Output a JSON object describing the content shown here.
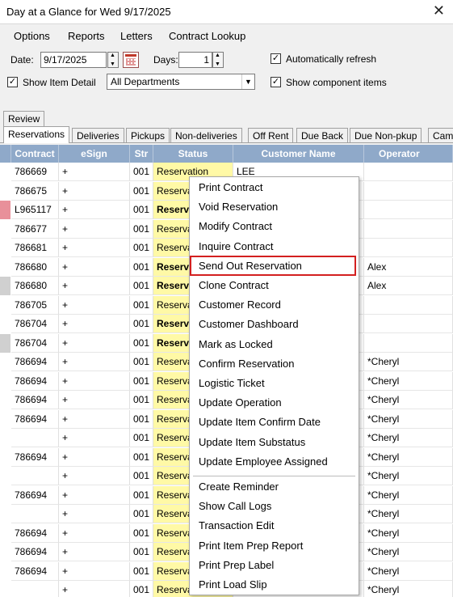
{
  "window": {
    "title": "Day at a Glance for Wed 9/17/2025",
    "close_label": "✕"
  },
  "menu": [
    "Options",
    "Reports",
    "Letters",
    "Contract Lookup"
  ],
  "filters": {
    "date_label": "Date:",
    "date_value": "9/17/2025",
    "days_label": "Days:",
    "days_value": "1",
    "auto_refresh_label": "Automatically refresh",
    "auto_refresh_checked": true,
    "show_item_detail_label": "Show Item Detail",
    "show_item_detail_checked": true,
    "department_value": "All Departments",
    "show_component_label": "Show component items",
    "show_component_checked": true
  },
  "tabs_top": [
    "Review"
  ],
  "tabs": [
    "Reservations",
    "Deliveries",
    "Pickups",
    "Non-deliveries",
    "Off Rent",
    "Due Back",
    "Due Non-pkup",
    "Cam"
  ],
  "columns": [
    "Contract",
    "eSign",
    "Str",
    "Status",
    "Customer Name",
    "Operator Assign"
  ],
  "rows": [
    {
      "contract": "786669",
      "esign": "+",
      "str": "001",
      "status": "Reservation",
      "customer": "LEE",
      "operator": "",
      "bold": false,
      "marker": ""
    },
    {
      "contract": "786675",
      "esign": "+",
      "str": "001",
      "status": "Reserva",
      "customer": "",
      "operator": "",
      "bold": false,
      "marker": ""
    },
    {
      "contract": "L965117",
      "esign": "+",
      "str": "001",
      "status": "Reserva",
      "customer": "",
      "operator": "",
      "bold": true,
      "marker": "#e8909a"
    },
    {
      "contract": "786677",
      "esign": "+",
      "str": "001",
      "status": "Reserva",
      "customer": "",
      "operator": "",
      "bold": false,
      "marker": ""
    },
    {
      "contract": "786681",
      "esign": "+",
      "str": "001",
      "status": "Reserva",
      "customer": "",
      "operator": "",
      "bold": false,
      "marker": ""
    },
    {
      "contract": "786680",
      "esign": "+",
      "str": "001",
      "status": "Reserva",
      "customer": "",
      "operator": "Alex",
      "bold": true,
      "marker": ""
    },
    {
      "contract": "786680",
      "esign": "+",
      "str": "001",
      "status": "Reserva",
      "customer": "",
      "operator": "Alex",
      "bold": true,
      "marker": "#d0d0d0"
    },
    {
      "contract": "786705",
      "esign": "+",
      "str": "001",
      "status": "Reserva",
      "customer": "",
      "operator": "",
      "bold": false,
      "marker": ""
    },
    {
      "contract": "786704",
      "esign": "+",
      "str": "001",
      "status": "Reserva",
      "customer": "",
      "operator": "",
      "bold": true,
      "marker": ""
    },
    {
      "contract": "786704",
      "esign": "+",
      "str": "001",
      "status": "Reserva",
      "customer": "",
      "operator": "",
      "bold": true,
      "marker": "#d0d0d0"
    },
    {
      "contract": "786694",
      "esign": "+",
      "str": "001",
      "status": "Reserva",
      "customer": "",
      "operator": "*Cheryl",
      "bold": false,
      "marker": ""
    },
    {
      "contract": "786694",
      "esign": "+",
      "str": "001",
      "status": "Reserva",
      "customer": "",
      "operator": "*Cheryl",
      "bold": false,
      "marker": ""
    },
    {
      "contract": "786694",
      "esign": "+",
      "str": "001",
      "status": "Reserva",
      "customer": "",
      "operator": "*Cheryl",
      "bold": false,
      "marker": ""
    },
    {
      "contract": "786694",
      "esign": "+",
      "str": "001",
      "status": "Reserva",
      "customer": "",
      "operator": "*Cheryl",
      "bold": false,
      "marker": ""
    },
    {
      "contract": "",
      "esign": "+",
      "str": "001",
      "status": "Reserva",
      "customer": "",
      "operator": "*Cheryl",
      "bold": false,
      "marker": ""
    },
    {
      "contract": "786694",
      "esign": "+",
      "str": "001",
      "status": "Reserva",
      "customer": "",
      "operator": "*Cheryl",
      "bold": false,
      "marker": ""
    },
    {
      "contract": "",
      "esign": "+",
      "str": "001",
      "status": "Reserva",
      "customer": "",
      "operator": "*Cheryl",
      "bold": false,
      "marker": ""
    },
    {
      "contract": "786694",
      "esign": "+",
      "str": "001",
      "status": "Reserva",
      "customer": "",
      "operator": "*Cheryl",
      "bold": false,
      "marker": ""
    },
    {
      "contract": "",
      "esign": "+",
      "str": "001",
      "status": "Reserva",
      "customer": "",
      "operator": "*Cheryl",
      "bold": false,
      "marker": ""
    },
    {
      "contract": "786694",
      "esign": "+",
      "str": "001",
      "status": "Reserva",
      "customer": "",
      "operator": "*Cheryl",
      "bold": false,
      "marker": ""
    },
    {
      "contract": "786694",
      "esign": "+",
      "str": "001",
      "status": "Reserva",
      "customer": "",
      "operator": "*Cheryl",
      "bold": false,
      "marker": ""
    },
    {
      "contract": "786694",
      "esign": "+",
      "str": "001",
      "status": "Reserva",
      "customer": "",
      "operator": "*Cheryl",
      "bold": false,
      "marker": ""
    },
    {
      "contract": "",
      "esign": "+",
      "str": "001",
      "status": "Reserva",
      "customer": "",
      "operator": "*Cheryl",
      "bold": false,
      "marker": ""
    },
    {
      "contract": "786694",
      "esign": "+",
      "str": "001",
      "status": "Reserva",
      "customer": "",
      "operator": "*Cheryl",
      "bold": false,
      "marker": ""
    }
  ],
  "context_menu": {
    "group1": [
      "Print Contract",
      "Void Reservation",
      "Modify Contract",
      "Inquire Contract",
      "Send Out Reservation",
      "Clone Contract",
      "Customer Record",
      "Customer Dashboard",
      "Mark as Locked",
      "Confirm Reservation",
      "Logistic Ticket",
      "Update Operation",
      "Update Item Confirm Date",
      "Update Item Substatus",
      "Update Employee Assigned"
    ],
    "group2": [
      "Create Reminder",
      "Show Call Logs",
      "Transaction Edit",
      "Print Item Prep Report",
      "Print Prep Label",
      "Print Load Slip"
    ],
    "highlighted": "Send Out Reservation"
  },
  "colors": {
    "header_bg": "#8fa9c9",
    "status_bg": "#fff9a6",
    "highlight_border": "#d32020"
  }
}
